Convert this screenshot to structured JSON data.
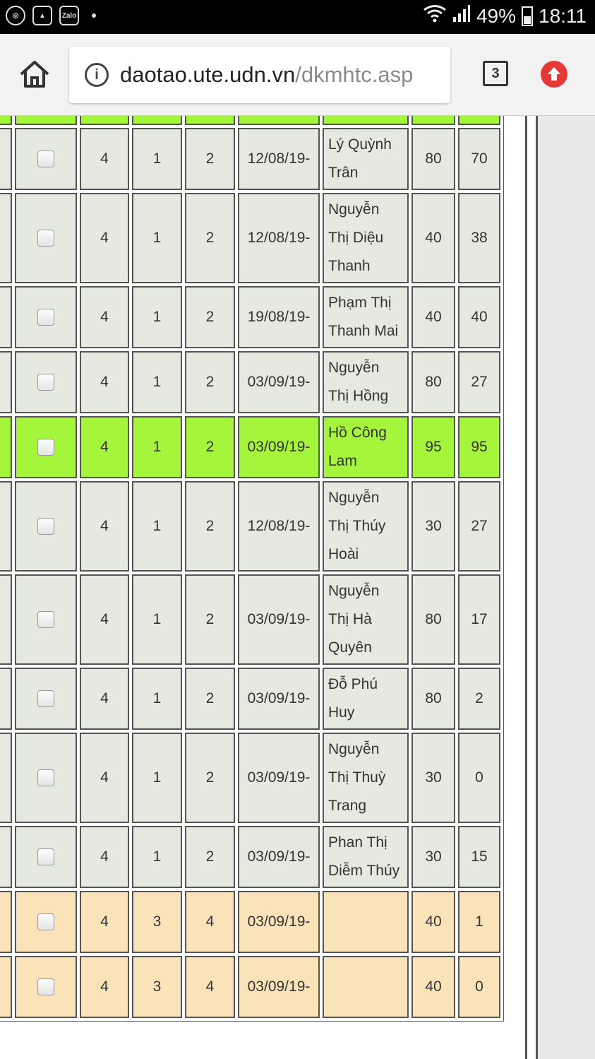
{
  "status_bar": {
    "left_icons": [
      "chrome-icon",
      "gallery-icon",
      "zalo-icon"
    ],
    "zalo_label": "Zalo",
    "battery": "49%",
    "time": "18:11"
  },
  "browser": {
    "url_domain": "daotao.ute.udn.vn",
    "url_path": "/dkmhtc.asp",
    "tab_count": "3"
  },
  "colors": {
    "highlight_row": "#a5f53c",
    "normal_row": "#e6e9df",
    "orange_row": "#fbe3b9",
    "update_button": "#e53935"
  },
  "table": {
    "rows": [
      {
        "style": "norm",
        "c1": "4",
        "c2": "1",
        "c3": "2",
        "date": "12/08/19-",
        "teacher": "Lý Quỳnh Trân",
        "capacity": "80",
        "registered": "70"
      },
      {
        "style": "norm",
        "c1": "4",
        "c2": "1",
        "c3": "2",
        "date": "12/08/19-",
        "teacher": "Nguyễn Thị Diệu Thanh",
        "capacity": "40",
        "registered": "38"
      },
      {
        "style": "norm",
        "c1": "4",
        "c2": "1",
        "c3": "2",
        "date": "19/08/19-",
        "teacher": "Phạm Thị Thanh Mai",
        "capacity": "40",
        "registered": "40"
      },
      {
        "style": "norm",
        "c1": "4",
        "c2": "1",
        "c3": "2",
        "date": "03/09/19-",
        "teacher": "Nguyễn Thị Hồng",
        "capacity": "80",
        "registered": "27"
      },
      {
        "style": "hl",
        "c1": "4",
        "c2": "1",
        "c3": "2",
        "date": "03/09/19-",
        "teacher": "Hồ Công Lam",
        "capacity": "95",
        "registered": "95"
      },
      {
        "style": "norm",
        "c1": "4",
        "c2": "1",
        "c3": "2",
        "date": "12/08/19-",
        "teacher": "Nguyễn Thị Thúy Hoài",
        "capacity": "30",
        "registered": "27"
      },
      {
        "style": "norm",
        "c1": "4",
        "c2": "1",
        "c3": "2",
        "date": "03/09/19-",
        "teacher": "Nguyễn Thị Hà Quyên",
        "capacity": "80",
        "registered": "17"
      },
      {
        "style": "norm",
        "c1": "4",
        "c2": "1",
        "c3": "2",
        "date": "03/09/19-",
        "teacher": "Đỗ Phú Huy",
        "capacity": "80",
        "registered": "2"
      },
      {
        "style": "norm",
        "c1": "4",
        "c2": "1",
        "c3": "2",
        "date": "03/09/19-",
        "teacher": "Nguyễn Thị Thuỳ Trang",
        "capacity": "30",
        "registered": "0"
      },
      {
        "style": "norm",
        "c1": "4",
        "c2": "1",
        "c3": "2",
        "date": "03/09/19-",
        "teacher": "Phan Thị Diễm Thúy",
        "capacity": "30",
        "registered": "15"
      },
      {
        "style": "orange",
        "c1": "4",
        "c2": "3",
        "c3": "4",
        "date": "03/09/19-",
        "teacher": "",
        "capacity": "40",
        "registered": "1"
      },
      {
        "style": "orange",
        "c1": "4",
        "c2": "3",
        "c3": "4",
        "date": "03/09/19-",
        "teacher": "",
        "capacity": "40",
        "registered": "0"
      }
    ]
  }
}
